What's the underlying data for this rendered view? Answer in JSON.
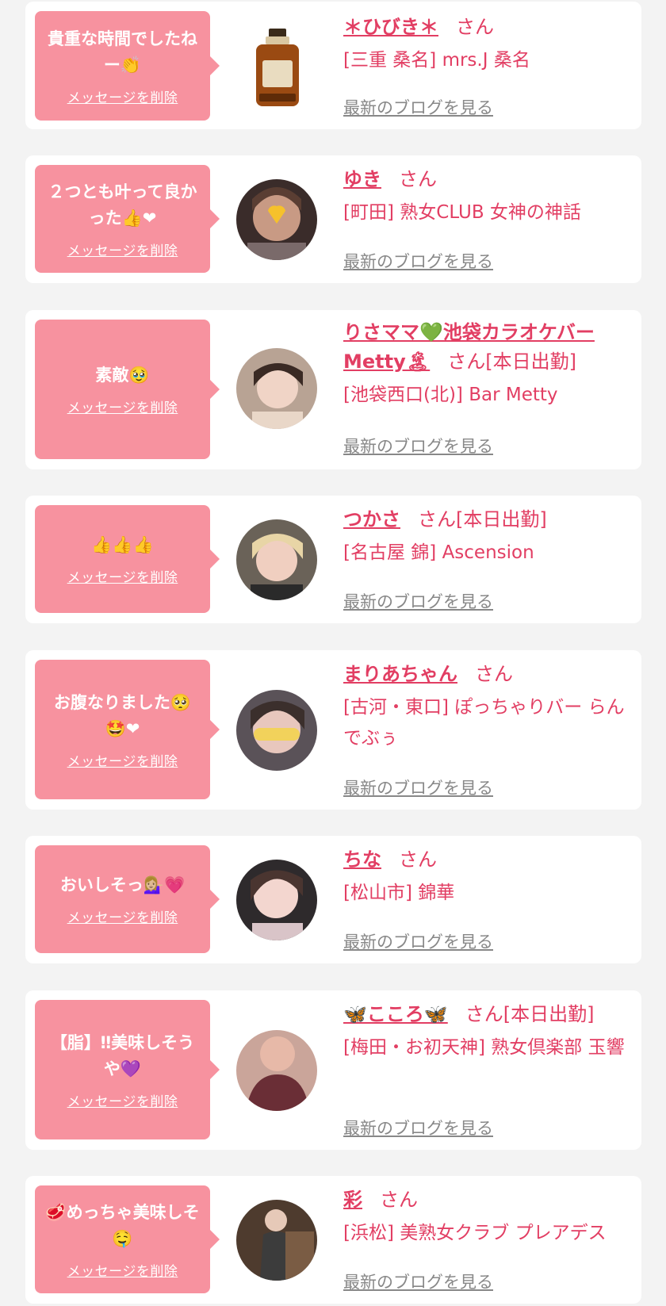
{
  "common": {
    "delete_label": "メッセージを削除",
    "blog_label": "最新のブログを見る",
    "honorific": "さん"
  },
  "colors": {
    "page_background": "#f3f3f3",
    "bubble": "#f7929f",
    "accent_text": "#e23e63",
    "link_gray": "#888888"
  },
  "cards": [
    {
      "message": "貴重な時間でしたねー👏",
      "name": "＊ひびき＊",
      "status": "",
      "shop": "[三重 桑名] mrs.J 桑名",
      "avatar_icon": "whisky-bottle-icon"
    },
    {
      "message": "２つとも叶って良かった👍❤",
      "name": "ゆき",
      "status": "",
      "shop": "[町田] 熟女CLUB 女神の神話",
      "avatar_icon": "avatar-photo"
    },
    {
      "message": "素敵🥹",
      "name": "りさママ💚池袋カラオケバーMetty🏝",
      "status": "[本日出勤]",
      "shop": "[池袋西口(北)] Bar Metty",
      "avatar_icon": "avatar-photo"
    },
    {
      "message": "👍👍👍",
      "name": "つかさ",
      "status": "[本日出勤]",
      "shop": "[名古屋 錦] Ascension",
      "avatar_icon": "avatar-photo"
    },
    {
      "message": "お腹なりました🥺🤩❤",
      "name": "まりあちゃん",
      "status": "",
      "shop": "[古河・東口] ぽっちゃりバー らんでぶぅ",
      "avatar_icon": "avatar-photo"
    },
    {
      "message": "おいしそっ💁🏼‍♀️💗",
      "name": "ちな",
      "status": "",
      "shop": "[松山市] 錦華",
      "avatar_icon": "avatar-photo"
    },
    {
      "message": "【脂】‼美味しそうや💜",
      "name": "🦋こころ🦋",
      "status": "[本日出勤]",
      "shop": "[梅田・お初天神] 熟女倶楽部 玉響",
      "avatar_icon": "avatar-photo"
    },
    {
      "message": "🥩めっちゃ美味しそ🤤",
      "name": "彩",
      "status": "",
      "shop": "[浜松] 美熟女クラブ プレアデス",
      "avatar_icon": "avatar-photo"
    }
  ]
}
